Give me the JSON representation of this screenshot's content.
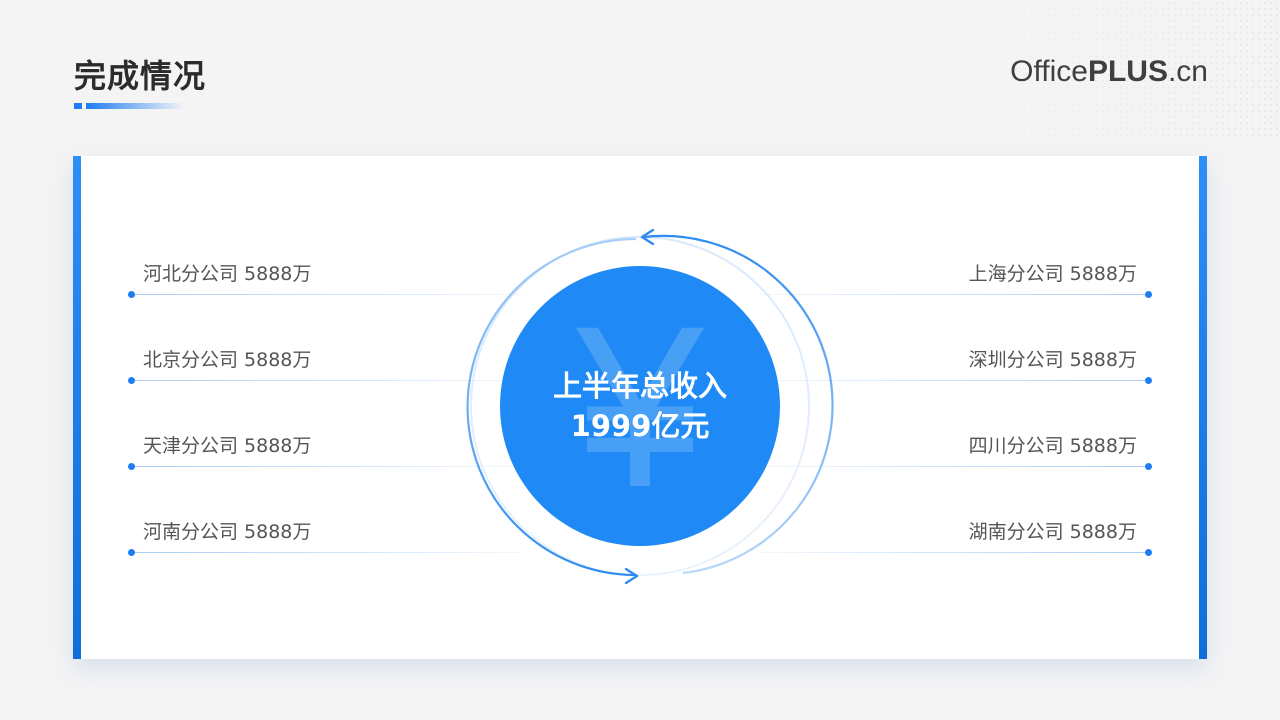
{
  "header": {
    "title": "完成情况",
    "logo_light": "Office",
    "logo_bold": "PLUS",
    "logo_suffix": ".cn"
  },
  "center": {
    "symbol": "¥",
    "line1": "上半年总收入",
    "line2": "1999亿元"
  },
  "left_items": [
    {
      "label": "河北分公司  5888万"
    },
    {
      "label": "北京分公司  5888万"
    },
    {
      "label": "天津分公司  5888万"
    },
    {
      "label": "河南分公司  5888万"
    }
  ],
  "right_items": [
    {
      "label": "上海分公司  5888万"
    },
    {
      "label": "深圳分公司  5888万"
    },
    {
      "label": "四川分公司  5888万"
    },
    {
      "label": "湖南分公司  5888万"
    }
  ],
  "colors": {
    "accent": "#1f7df3",
    "circle": "#1f8af5",
    "background": "#f4f4f5"
  }
}
